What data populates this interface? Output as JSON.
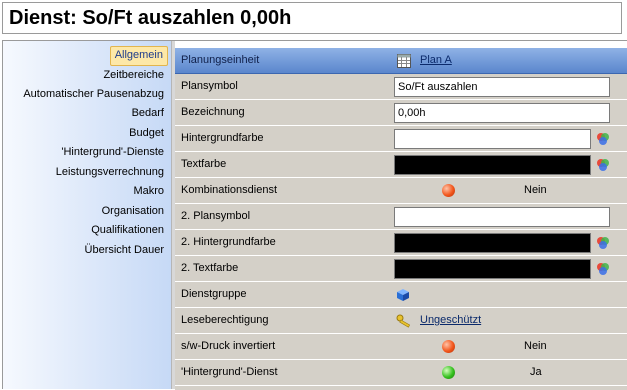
{
  "window": {
    "title": "Dienst: So/Ft auszahlen 0,00h"
  },
  "nav": {
    "items": [
      {
        "label": "Allgemein",
        "active": true
      },
      {
        "label": "Zeitbereiche"
      },
      {
        "label": "Automatischer Pausenabzug"
      },
      {
        "label": "Bedarf"
      },
      {
        "label": "Budget"
      },
      {
        "label": "'Hintergrund'-Dienste"
      },
      {
        "label": "Leistungsverrechnung"
      },
      {
        "label": "Makro"
      },
      {
        "label": "Organisation"
      },
      {
        "label": "Qualifikationen"
      },
      {
        "label": "Übersicht Dauer"
      }
    ]
  },
  "properties": {
    "planungseinheit": {
      "label": "Planungseinheit",
      "value": "Plan A",
      "icon": "calendar-icon"
    },
    "plansymbol": {
      "label": "Plansymbol",
      "value": "So/Ft auszahlen"
    },
    "bezeichnung": {
      "label": "Bezeichnung",
      "value": "0,00h"
    },
    "hintergrundfarbe": {
      "label": "Hintergrundfarbe",
      "color": "#ffffff",
      "icon": "color-picker-icon"
    },
    "textfarbe": {
      "label": "Textfarbe",
      "color": "#000000",
      "icon": "color-picker-icon"
    },
    "kombinationsdienst": {
      "label": "Kombinationsdienst",
      "status": "red",
      "value": "Nein"
    },
    "plansymbol2": {
      "label": "2. Plansymbol",
      "value": ""
    },
    "hintergrundfarbe2": {
      "label": "2. Hintergrundfarbe",
      "color": "#000000",
      "icon": "color-picker-icon"
    },
    "textfarbe2": {
      "label": "2. Textfarbe",
      "color": "#000000",
      "icon": "color-picker-icon"
    },
    "dienstgruppe": {
      "label": "Dienstgruppe",
      "icon": "cube-icon"
    },
    "leseberechtigung": {
      "label": "Leseberechtigung",
      "value": "Ungeschützt",
      "icon": "key-icon"
    },
    "sw_druck": {
      "label": "s/w-Druck invertiert",
      "status": "red",
      "value": "Nein"
    },
    "hintergrund_dienst": {
      "label": "'Hintergrund'-Dienst",
      "status": "green",
      "value": "Ja"
    }
  },
  "colors": {
    "header_blue": "#5a86cd",
    "grid_bg": "#d4d0c8",
    "nav_active": "#fde8a8"
  }
}
